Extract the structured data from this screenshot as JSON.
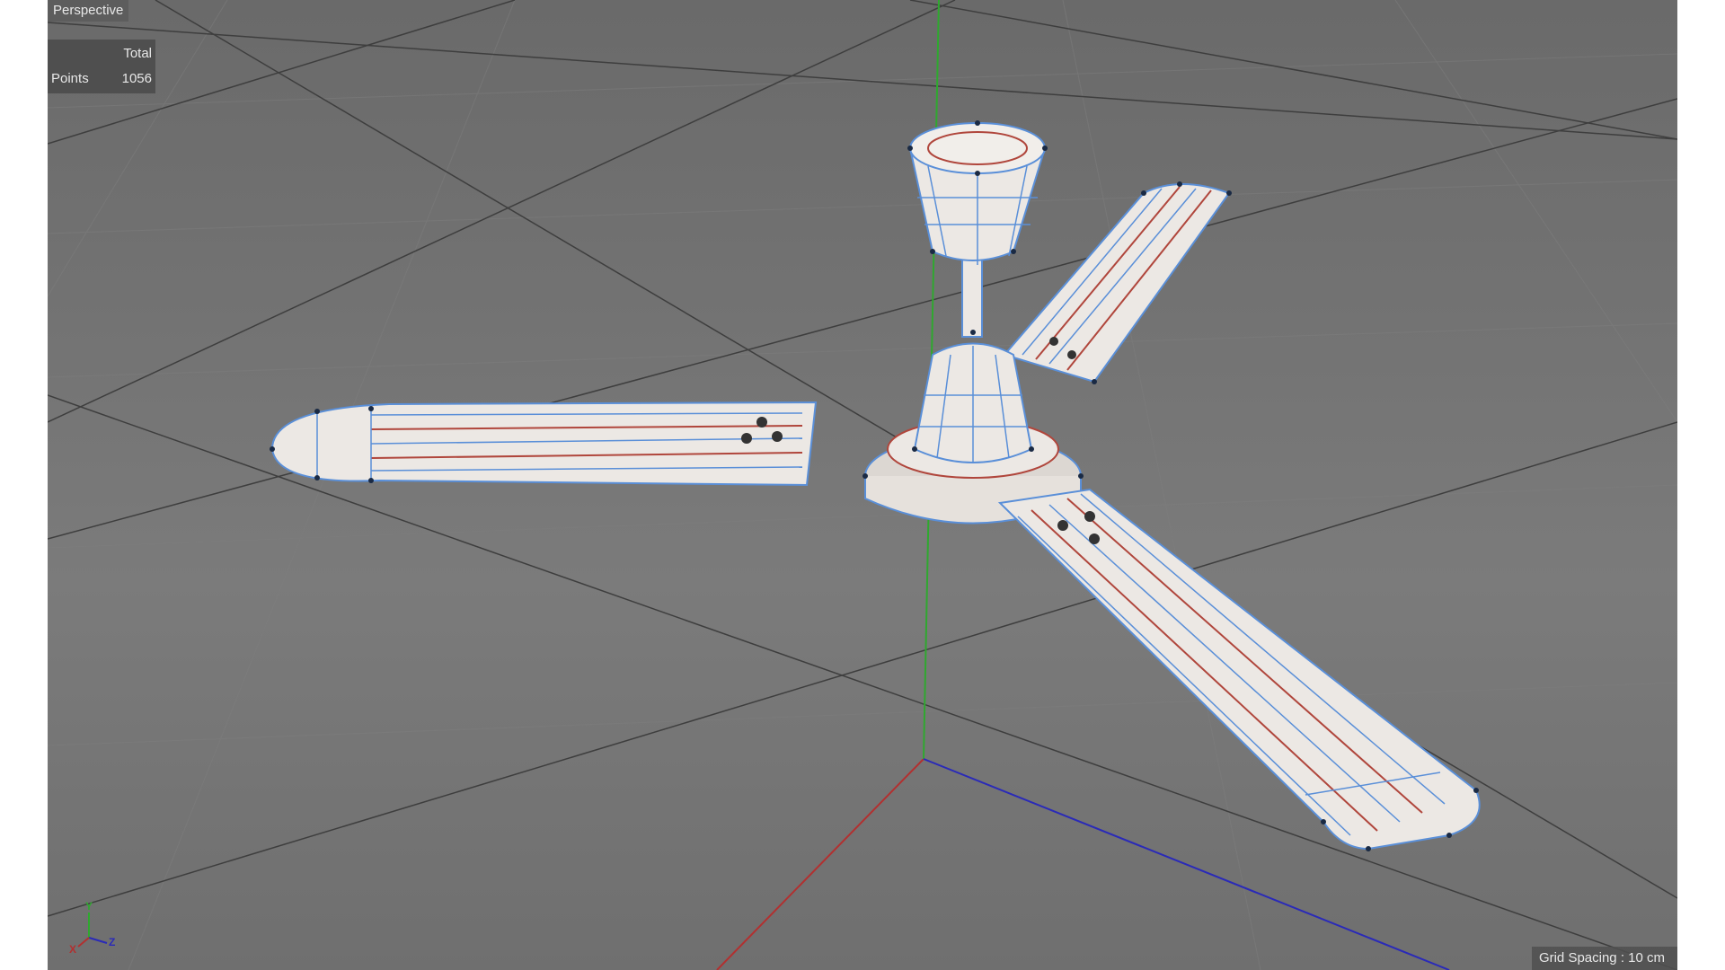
{
  "viewport": {
    "view_name": "Perspective",
    "stats": {
      "header": "Total",
      "points_label": "Points",
      "points_value": "1056"
    },
    "grid_spacing": "Grid Spacing : 10 cm"
  },
  "axis_gizmo": {
    "y": "Y",
    "z": "Z",
    "x": "X"
  },
  "colors": {
    "background": "#737373",
    "grid_major": "#3c3c3c",
    "grid_minor": "#808080",
    "axis_x": "#b23030",
    "axis_y": "#2fa82f",
    "axis_z": "#2a2ab8",
    "mesh_fill": "#ece8e4",
    "edge_blue": "#5a8fd8",
    "edge_red": "#b0463c",
    "vertex": "#1a2a44"
  },
  "scene_object": "ceiling-fan"
}
